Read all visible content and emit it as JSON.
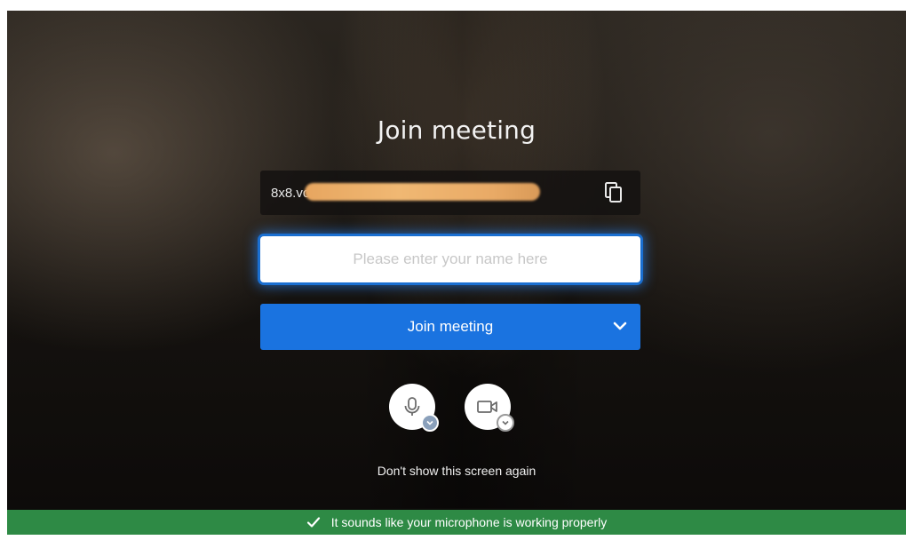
{
  "dialog": {
    "title": "Join meeting",
    "meeting_url_visible": "8x8.vc",
    "name_placeholder": "Please enter your name here",
    "join_label": "Join meeting",
    "dont_show_label": "Don't show this screen again"
  },
  "icons": {
    "copy": "copy-icon",
    "chevron": "chevron-down-icon",
    "microphone": "microphone-icon",
    "camera": "camera-icon",
    "check": "check-icon"
  },
  "status": {
    "message": "It sounds like your microphone is working properly"
  },
  "colors": {
    "primary_button": "#1a73e0",
    "status_bar": "#2e8a45",
    "input_focus_glow": "#1a6fd1"
  }
}
